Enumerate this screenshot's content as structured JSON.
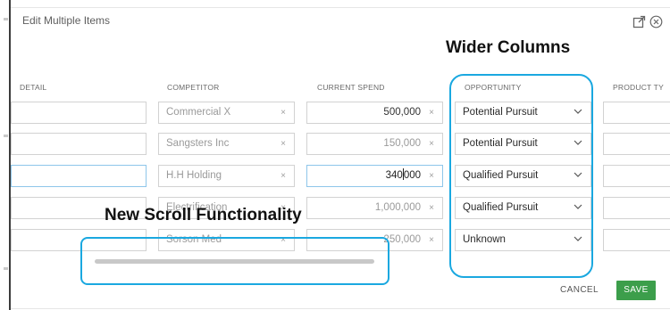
{
  "dialog": {
    "title": "Edit Multiple Items",
    "icons": [
      "popout-icon",
      "close-circle-icon"
    ]
  },
  "columns": {
    "detail": "DETAIL",
    "competitor": "COMPETITOR",
    "current_spend": "CURRENT SPEND",
    "opportunity": "OPPORTUNITY",
    "product_type": "PRODUCT TY"
  },
  "rows": [
    {
      "competitor": "Commercial X",
      "spend": "500,000",
      "opportunity": "Potential Pursuit"
    },
    {
      "competitor": "Sangsters Inc",
      "spend": "150,000",
      "opportunity": "Potential Pursuit"
    },
    {
      "competitor": "H.H Holding",
      "spend_pre_caret": "340",
      "spend_post_caret": "000",
      "opportunity": "Qualified Pursuit"
    },
    {
      "competitor": "Electrification",
      "spend": "1,000,000",
      "opportunity": "Qualified Pursuit"
    },
    {
      "competitor": "Sorson Med",
      "spend": "250,000",
      "opportunity": "Unknown"
    }
  ],
  "clear_glyph": "×",
  "annotations": {
    "wider_columns": "Wider Columns",
    "new_scroll": "New Scroll Functionality"
  },
  "footer": {
    "cancel": "CANCEL",
    "save": "SAVE"
  },
  "colors": {
    "highlight": "#1aa8e0",
    "save_button": "#3c9e4b",
    "focus_border": "#8ec6ea"
  }
}
